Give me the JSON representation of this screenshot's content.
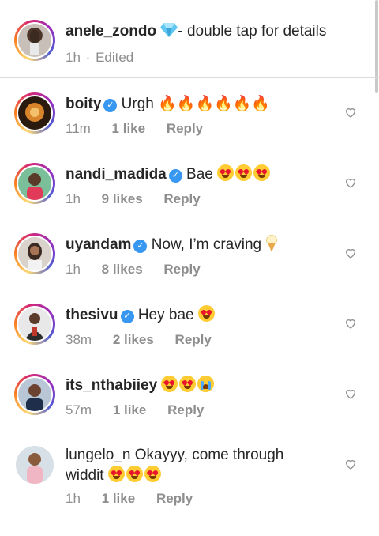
{
  "caption": {
    "username": "anele_zondo",
    "text": "- double tap for details",
    "time": "1h",
    "edited": "Edited"
  },
  "comments": [
    {
      "username": "boity",
      "verified": true,
      "text": "Urgh",
      "time": "11m",
      "likes": "1 like",
      "reply": "Reply"
    },
    {
      "username": "nandi_madida",
      "verified": true,
      "text": "Bae",
      "time": "1h",
      "likes": "9 likes",
      "reply": "Reply"
    },
    {
      "username": "uyandam",
      "verified": true,
      "text": "Now, I’m craving",
      "time": "1h",
      "likes": "8 likes",
      "reply": "Reply"
    },
    {
      "username": "thesivu",
      "verified": true,
      "text": "Hey bae",
      "time": "38m",
      "likes": "2 likes",
      "reply": "Reply"
    },
    {
      "username": "its_nthabiiey",
      "verified": false,
      "text": "",
      "time": "57m",
      "likes": "1 like",
      "reply": "Reply"
    },
    {
      "username": "lungelo_n",
      "verified": false,
      "text": "Okayyy, come through",
      "text_line2": "widdit",
      "time": "1h",
      "likes": "1 like",
      "reply": "Reply"
    }
  ],
  "icons": {
    "verified": "verified-check-icon",
    "like": "heart-outline-icon",
    "diamond": "gem-emoji",
    "fire": "fire-emoji",
    "heart_eyes": "heart-eyes-emoji",
    "ice_cream": "ice-cream-emoji",
    "crying": "crying-face-emoji"
  },
  "colors": {
    "verified": "#3897f0",
    "muted": "#8e8e8e",
    "text": "#262626"
  }
}
